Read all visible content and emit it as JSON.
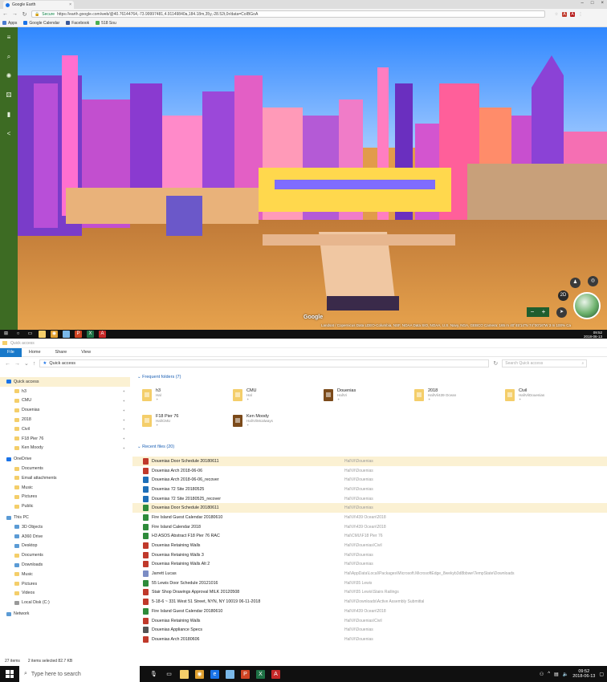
{
  "browser": {
    "tab_title": "Google Earth",
    "secure_label": "Secure",
    "url": "https://earth.google.com/web/@40.76144764,-73.99997481,4.91149840a,184.18m,35y,-28.52t,0r/data=CoIBGoA",
    "bookmarks": [
      {
        "label": "Apps",
        "color": "#4a7bd0"
      },
      {
        "label": "Google Calendar",
        "color": "#1a73e8"
      },
      {
        "label": "Facebook",
        "color": "#3b5998"
      },
      {
        "label": "518 Sou",
        "color": "#4caf50"
      }
    ]
  },
  "earth": {
    "brand": "Google",
    "attribution": "Landsat / Copernicus  Data LDEO-Columbia, NSF, NOAA  Data SIO, NOAA, U.S. Navy, NGA, GEBCO    Camera: 165 m   40°45'14\"N 74°00'16\"W    3 m   100%  Ca",
    "mode_2d": "2D",
    "sidebar_icons": [
      "menu-icon",
      "search-icon",
      "voyager-icon",
      "random-icon",
      "bookmark-icon",
      "share-icon"
    ]
  },
  "top_taskbar": {
    "time": "09:52",
    "date": "2018-06-13"
  },
  "explorer": {
    "title": "Quick access",
    "ribbon_tabs": [
      "File",
      "Home",
      "Share",
      "View"
    ],
    "breadcrumb": "Quick access",
    "search_placeholder": "Search Quick access",
    "nav_items": [
      {
        "label": "Quick access",
        "indent": 0,
        "type": "star",
        "selected": true
      },
      {
        "label": "h3",
        "indent": 1,
        "type": "folder"
      },
      {
        "label": "CMU",
        "indent": 1,
        "type": "folder"
      },
      {
        "label": "Douenias",
        "indent": 1,
        "type": "folder"
      },
      {
        "label": "2018",
        "indent": 1,
        "type": "folder"
      },
      {
        "label": "Civil",
        "indent": 1,
        "type": "folder"
      },
      {
        "label": "F18 Pier 76",
        "indent": 1,
        "type": "folder"
      },
      {
        "label": "Ken Moody",
        "indent": 1,
        "type": "folder"
      },
      {
        "label": "OneDrive",
        "indent": 0,
        "type": "cloud",
        "gap": true
      },
      {
        "label": "Documents",
        "indent": 1,
        "type": "folder"
      },
      {
        "label": "Email attachments",
        "indent": 1,
        "type": "folder"
      },
      {
        "label": "Music",
        "indent": 1,
        "type": "folder"
      },
      {
        "label": "Pictures",
        "indent": 1,
        "type": "folder"
      },
      {
        "label": "Public",
        "indent": 1,
        "type": "folder"
      },
      {
        "label": "This PC",
        "indent": 0,
        "type": "pc",
        "gap": true
      },
      {
        "label": "3D Objects",
        "indent": 1,
        "type": "blue"
      },
      {
        "label": "A360 Drive",
        "indent": 1,
        "type": "blue"
      },
      {
        "label": "Desktop",
        "indent": 1,
        "type": "blue"
      },
      {
        "label": "Documents",
        "indent": 1,
        "type": "folder"
      },
      {
        "label": "Downloads",
        "indent": 1,
        "type": "blue"
      },
      {
        "label": "Music",
        "indent": 1,
        "type": "folder"
      },
      {
        "label": "Pictures",
        "indent": 1,
        "type": "folder"
      },
      {
        "label": "Videos",
        "indent": 1,
        "type": "folder"
      },
      {
        "label": "Local Disk (C:)",
        "indent": 1,
        "type": "disk"
      },
      {
        "label": "Network",
        "indent": 0,
        "type": "net",
        "gap": true
      }
    ],
    "frequent_header": "Frequent folders (7)",
    "frequent_folders": [
      {
        "name": "h3",
        "path": "Hal",
        "dark": false
      },
      {
        "name": "CMU",
        "path": "Hal",
        "dark": false
      },
      {
        "name": "Douenias",
        "path": "Hal\\Vi",
        "dark": true
      },
      {
        "name": "2018",
        "path": "Hal\\Vi\\439 Ocean",
        "dark": false
      },
      {
        "name": "Civil",
        "path": "Hal\\Vi\\Douenias",
        "dark": false
      },
      {
        "name": "F18 Pier 76",
        "path": "Hal\\CMU",
        "dark": false
      },
      {
        "name": "Ken Moody",
        "path": "Hal\\Vi\\Mcalways",
        "dark": true
      }
    ],
    "recent_header": "Recent files (20)",
    "recent_files": [
      {
        "name": "Douenias Door Schedule 20180611",
        "location": "Hal\\Vi\\Douenias",
        "color": "#c0392b",
        "selected": true
      },
      {
        "name": "Douenias Arch 2018-06-06",
        "location": "Hal\\Vi\\Douenias",
        "color": "#c0392b"
      },
      {
        "name": "Douenias Arch 2018-06-06_recover",
        "location": "Hal\\Vi\\Douenias",
        "color": "#1e6fb8"
      },
      {
        "name": "Douenias 72 Site 20180525",
        "location": "Hal\\Vi\\Douenias",
        "color": "#1e6fb8"
      },
      {
        "name": "Douenias 72 Site 20180525_recover",
        "location": "Hal\\Vi\\Douenias",
        "color": "#1e6fb8"
      },
      {
        "name": "Douenias Door Schedule 20180611",
        "location": "Hal\\Vi\\Douenias",
        "color": "#2e8b3a",
        "selected": true
      },
      {
        "name": "Fire Island Guest Calendar 20180610",
        "location": "Hal\\Vi\\439 Ocean\\2018",
        "color": "#2e8b3a"
      },
      {
        "name": "Fire Island Calendar 2018",
        "location": "Hal\\Vi\\439 Ocean\\2018",
        "color": "#2e8b3a"
      },
      {
        "name": "H3 ASOS Abstract F18 Pier 76 RAC",
        "location": "Hal\\CMU\\F18 Pier 76",
        "color": "#2e8b3a"
      },
      {
        "name": "Douenias Retaining Walls",
        "location": "Hal\\Vi\\Douenias\\Civil",
        "color": "#c0392b"
      },
      {
        "name": "Douenias Retaining Walls 3",
        "location": "Hal\\Vi\\Douenias",
        "color": "#c0392b"
      },
      {
        "name": "Douenias Retaining Walls Alt 2",
        "location": "Hal\\Vi\\Douenias",
        "color": "#c0392b"
      },
      {
        "name": "Jarrett Lucas",
        "location": "Hal\\AppData\\Local\\Packages\\Microsoft.MicrosoftEdge_8wekyb3d8bbwe\\TempState\\Downloads",
        "color": "#7b8cc4"
      },
      {
        "name": "55 Lewis Door Schedule 20121016",
        "location": "Hal\\Vi\\55 Lewis",
        "color": "#2e8b3a"
      },
      {
        "name": "Stair Shop Drawings Approval MILK 20120508",
        "location": "Hal\\Vi\\55 Lewis\\Stairs Railings",
        "color": "#c0392b"
      },
      {
        "name": "5-18-6 ~ 331 West 51 Street, NYN, NY 10019 06-11-2018",
        "location": "Hal\\Vi\\Downloads\\Active Assembly Submittal",
        "color": "#c0392b"
      },
      {
        "name": "Fire Island Guest Calendar 20180610",
        "location": "Hal\\Vi\\439 Ocean\\2018",
        "color": "#2e8b3a"
      },
      {
        "name": "Douenias Retaining Walls",
        "location": "Hal\\Vi\\Douenias\\Civil",
        "color": "#c0392b"
      },
      {
        "name": "Douenias Appliance Specs",
        "location": "Hal\\Vi\\Douenias",
        "color": "#555555"
      },
      {
        "name": "Douenias Arch 20180606",
        "location": "Hal\\Vi\\Douenias",
        "color": "#c0392b"
      }
    ],
    "status_count": "27 items",
    "status_selected": "2 items selected  82.7 KB"
  },
  "taskbar": {
    "search_placeholder": "Type here to search",
    "time": "09:52",
    "date": "2018-06-13"
  }
}
